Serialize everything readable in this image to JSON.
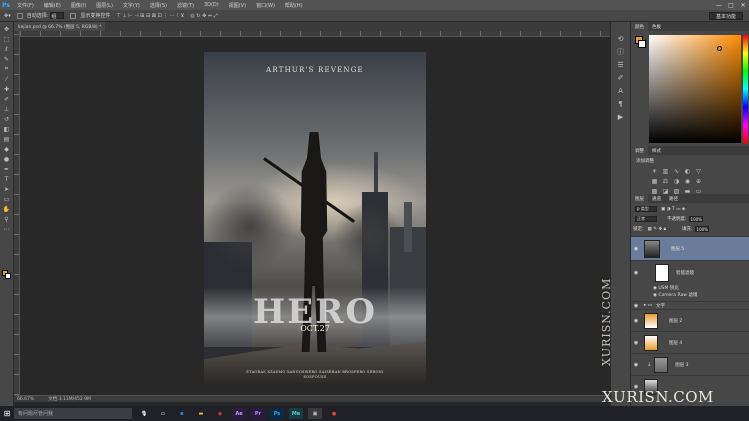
{
  "app": {
    "logo": "Ps"
  },
  "menu": [
    "文件(F)",
    "编辑(E)",
    "图像(I)",
    "图层(L)",
    "文字(Y)",
    "选择(S)",
    "滤镜(T)",
    "3D(D)",
    "视图(V)",
    "窗口(W)",
    "帮助(H)"
  ],
  "window_controls": {
    "minimize": "—",
    "maximize": "□",
    "close": "✕"
  },
  "options": {
    "auto_select_label": "自动选择:",
    "auto_select_value": "组",
    "show_transform": "显示变换控件",
    "workspace": "基本功能"
  },
  "document": {
    "tab_title": "kejian.psd @ 66.7% (图层 5, RGB/8) *",
    "status_zoom": "66.67%",
    "status_doc": "文档:3.11M/452.9M"
  },
  "poster": {
    "title": "ARTHUR'S REVENGE",
    "hero": "HERO",
    "date": "OCT.27",
    "credits_line1": "ETAGRAS  XZASMO  XANGOSWERO  SAISERAN  BROSPERO  SERONI",
    "credits_line2": "SOSPOUSS"
  },
  "panels": {
    "color_tabs": [
      "颜色",
      "色板"
    ],
    "adjust_tabs": [
      "调整",
      "样式"
    ],
    "adjust_title": "添加调整",
    "layers_tabs": [
      "图层",
      "通道",
      "路径"
    ],
    "filter_label": "p 类型",
    "blend_mode": "正常",
    "opacity_label": "不透明度:",
    "opacity_value": "100%",
    "lock_label": "锁定:",
    "fill_label": "填充:",
    "fill_value": "100%",
    "layers": [
      {
        "name": "图层 5",
        "selected": true
      },
      {
        "name": "智能滤镜",
        "selected": false
      },
      {
        "name": "USM 锐化",
        "selected": false
      },
      {
        "name": "Camera Raw 滤镜",
        "selected": false
      },
      {
        "name": "文字",
        "selected": false
      },
      {
        "name": "图层 2",
        "selected": false
      },
      {
        "name": "图层 4",
        "selected": false
      },
      {
        "name": "图层 3",
        "selected": false
      }
    ]
  },
  "watermark": {
    "vertical": "XURISN.COM",
    "horizontal": "XURISN.COM"
  },
  "taskbar": {
    "search_placeholder": "有问题尽管问我"
  },
  "colors": {
    "foreground": "#e8a020",
    "background": "#ffffff",
    "selection": "#6a7c9a"
  }
}
